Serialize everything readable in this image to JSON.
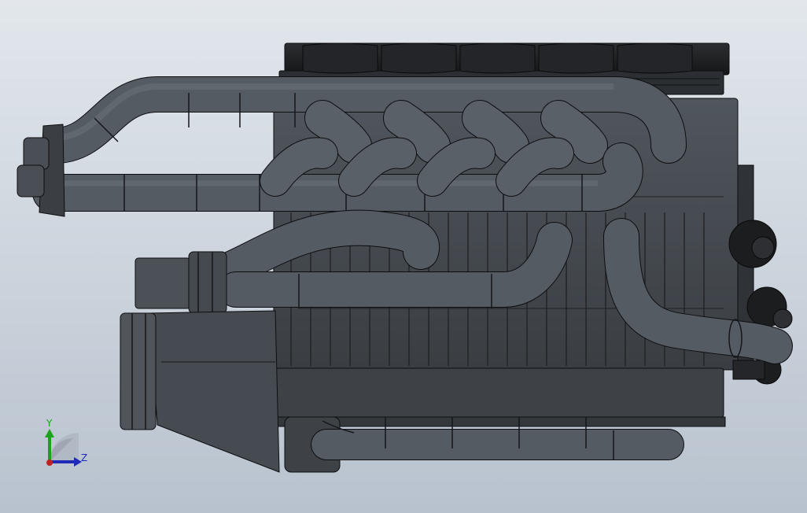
{
  "viewport": {
    "background_top": "#e2e7ec",
    "background_bottom": "#b8c2ce",
    "model_color": "#4d5258",
    "model_dark": "#202225",
    "edge_color": "#0d0e10"
  },
  "triad": {
    "y_label": "Y",
    "z_label": "Z",
    "y_color": "#1aa31a",
    "z_color": "#1f2ab8",
    "x_color": "#c42020",
    "label_y_color": "#1aa31a",
    "label_z_color": "#1f2ab8"
  }
}
